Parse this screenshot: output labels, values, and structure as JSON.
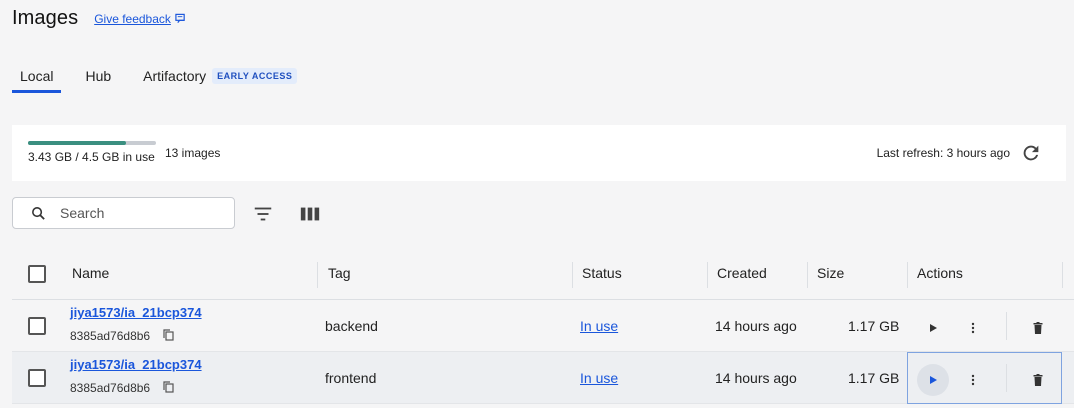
{
  "header": {
    "title": "Images",
    "feedback": "Give feedback"
  },
  "tabs": [
    {
      "label": "Local",
      "active": true
    },
    {
      "label": "Hub",
      "active": false
    },
    {
      "label": "Artifactory",
      "active": false,
      "badge": "EARLY ACCESS"
    }
  ],
  "usage": {
    "used_text": "3.43 GB / 4.5 GB in use",
    "fraction": 0.762,
    "count": "13 images",
    "last_refresh": "Last refresh: 3 hours ago"
  },
  "search": {
    "placeholder": "Search"
  },
  "table": {
    "headers": {
      "name": "Name",
      "tag": "Tag",
      "status": "Status",
      "created": "Created",
      "size": "Size",
      "actions": "Actions"
    },
    "rows": [
      {
        "name": "jiya1573/ia_21bcp374",
        "id": "8385ad76d8b6",
        "tag": "backend",
        "status": "In use",
        "created": "14 hours ago",
        "size": "1.17 GB"
      },
      {
        "name": "jiya1573/ia_21bcp374",
        "id": "8385ad76d8b6",
        "tag": "frontend",
        "status": "In use",
        "created": "14 hours ago",
        "size": "1.17 GB"
      }
    ]
  },
  "colors": {
    "accent": "#1a56db",
    "bar_fill": "#3a8f80"
  }
}
